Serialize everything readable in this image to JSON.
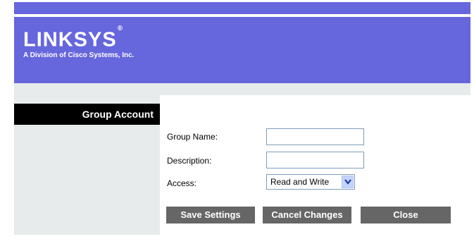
{
  "brand": {
    "logo_text": "LINKSYS",
    "logo_mark": "®",
    "tagline": "A Division of Cisco Systems, Inc."
  },
  "sidebar": {
    "title": "Group Account"
  },
  "form": {
    "group_name": {
      "label": "Group Name:",
      "value": ""
    },
    "description": {
      "label": "Description:",
      "value": ""
    },
    "access": {
      "label": "Access:",
      "selected": "Read and Write"
    }
  },
  "buttons": {
    "save": "Save Settings",
    "cancel": "Cancel Changes",
    "close": "Close"
  },
  "colors": {
    "header": "#6666dd",
    "band": "#e7ebeb",
    "button": "#666666"
  }
}
